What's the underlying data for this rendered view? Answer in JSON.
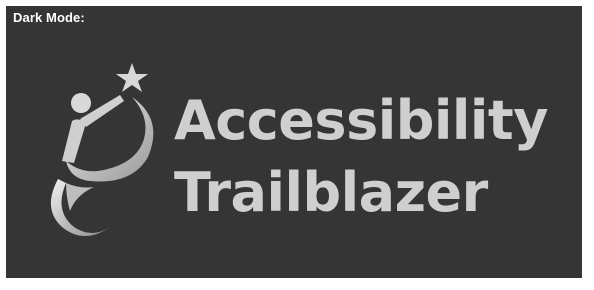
{
  "label": "Dark Mode:",
  "logo": {
    "line1": "Accessibility",
    "line2": "Trailblazer",
    "icon": "wheelchair-figure-star-icon"
  },
  "colors": {
    "background": "#353535",
    "text": "#cfcfcf",
    "label": "#ffffff"
  }
}
